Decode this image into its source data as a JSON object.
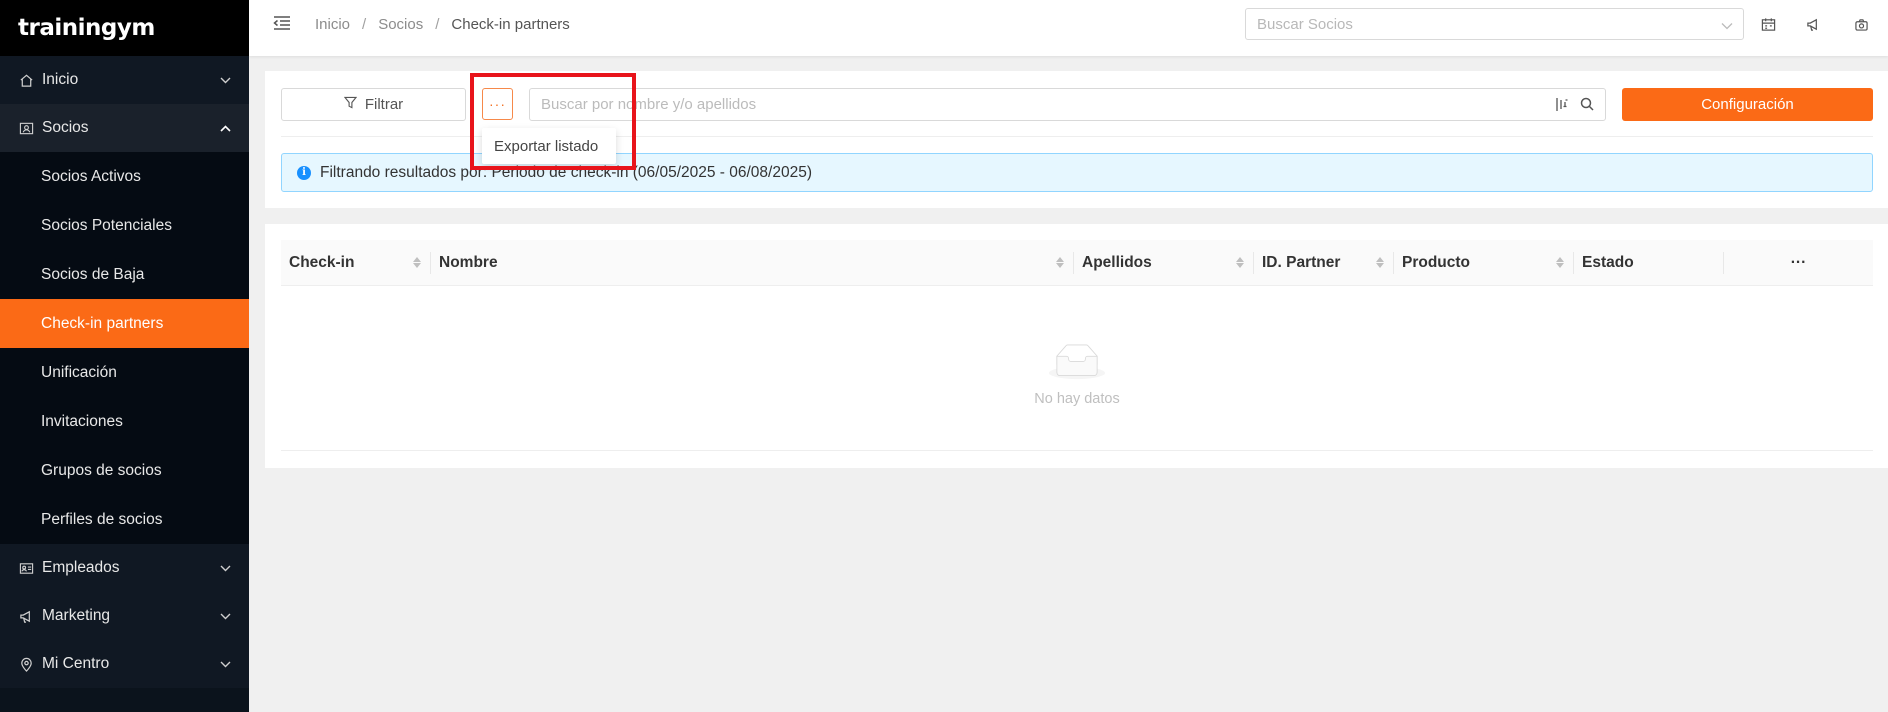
{
  "brand": {
    "logo": "trainingym"
  },
  "sidebar": {
    "items": [
      {
        "label": "Inicio",
        "icon": "home-icon"
      },
      {
        "label": "Socios",
        "icon": "member-card-icon",
        "expanded": true
      },
      {
        "label": "Empleados",
        "icon": "id-card-icon"
      },
      {
        "label": "Marketing",
        "icon": "megaphone-icon"
      },
      {
        "label": "Mi Centro",
        "icon": "location-pin-icon"
      }
    ],
    "socios_sub": [
      "Socios Activos",
      "Socios Potenciales",
      "Socios de Baja",
      "Check-in partners",
      "Unificación",
      "Invitaciones",
      "Grupos de socios",
      "Perfiles de socios"
    ],
    "active_sub": "Check-in partners"
  },
  "breadcrumb": [
    "Inicio",
    "Socios",
    "Check-in partners"
  ],
  "header": {
    "search_placeholder": "Buscar Socios"
  },
  "toolbar": {
    "filter_label": "Filtrar",
    "more_label": "···",
    "search_placeholder": "Buscar por nombre y/o apellidos",
    "config_label": "Configuración",
    "dropdown_item": "Exportar listado"
  },
  "alert": {
    "text": "Filtrando resultados por: Periodo de check-in (06/05/2025 - 06/08/2025)"
  },
  "table": {
    "columns": [
      "Check-in",
      "Nombre",
      "Apellidos",
      "ID. Partner",
      "Producto",
      "Estado"
    ],
    "more_label": "···",
    "empty_text": "No hay datos"
  },
  "colors": {
    "accent": "#fb6a16",
    "sidebar_bg": "#0b131c",
    "info_bg": "#e6f7ff",
    "highlight": "#e8141b"
  }
}
